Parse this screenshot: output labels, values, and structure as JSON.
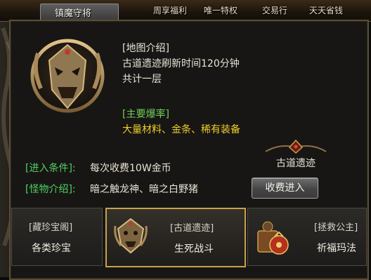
{
  "window": {
    "title": "镇魔守将",
    "top_menu": [
      "周享福利",
      "唯一特权",
      "交易行",
      "天天省钱"
    ]
  },
  "map_info": {
    "header": "[地图介绍]",
    "refresh": "古道遗迹刷新时间120分钟",
    "floors": "共计一层",
    "drop_header": "[主要爆率]",
    "drops": "大量材料、金条、稀有装备"
  },
  "conditions": {
    "entry_label": "[进入条件]:",
    "entry_value": "每次收费10W金币",
    "monster_label": "[怪物介绍]:",
    "monster_value": "暗之触龙神、暗之白野猪"
  },
  "portal": {
    "name": "古道遗迹",
    "enter_button": "收费进入"
  },
  "cards": [
    {
      "title": "[藏珍宝阁]",
      "subtitle": "各类珍宝",
      "icon": "none"
    },
    {
      "title": "[古道遗迹]",
      "subtitle": "生死战斗",
      "icon": "demon-emblem-icon"
    },
    {
      "title": "[拯救公主]",
      "subtitle": "祈福玛法",
      "icon": "treasure-bag-icon"
    }
  ],
  "colors": {
    "accent_gold": "#c9a14a",
    "label_green": "#4fd160",
    "drop_yellow": "#f0cf2a"
  }
}
